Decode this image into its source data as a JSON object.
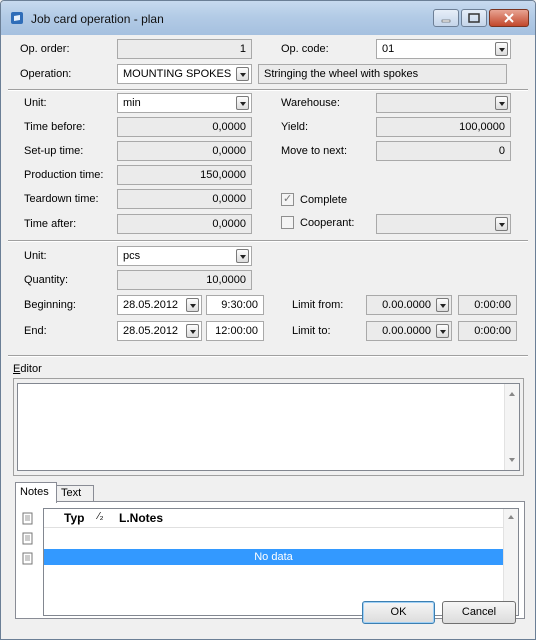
{
  "window": {
    "title": "Job card operation - plan"
  },
  "op": {
    "order_label": "Op. order:",
    "order_value": "1",
    "code_label": "Op. code:",
    "code_value": "01",
    "operation_label": "Operation:",
    "operation_value": "MOUNTING SPOKES",
    "operation_desc": "Stringing the wheel with spokes"
  },
  "time": {
    "unit_label": "Unit:",
    "unit_value": "min",
    "warehouse_label": "Warehouse:",
    "warehouse_value": "",
    "before_label": "Time before:",
    "before_value": "0,0000",
    "yield_label": "Yield:",
    "yield_value": "100,0000",
    "setup_label": "Set-up time:",
    "setup_value": "0,0000",
    "move_label": "Move to next:",
    "move_value": "0",
    "production_label": "Production time:",
    "production_value": "150,0000",
    "teardown_label": "Teardown time:",
    "teardown_value": "0,0000",
    "complete_label": "Complete",
    "complete_checked": true,
    "after_label": "Time after:",
    "after_value": "0,0000",
    "cooperant_label": "Cooperant:",
    "cooperant_checked": false,
    "cooperant_value": ""
  },
  "qty": {
    "unit_label": "Unit:",
    "unit_value": "pcs",
    "quantity_label": "Quantity:",
    "quantity_value": "10,0000",
    "beginning_label": "Beginning:",
    "beginning_date": "28.05.2012",
    "beginning_time": "9:30:00",
    "limit_from_label": "Limit from:",
    "limit_from_date": "0.00.0000",
    "limit_from_time": "0:00:00",
    "end_label": "End:",
    "end_date": "28.05.2012",
    "end_time": "12:00:00",
    "limit_to_label": "Limit to:",
    "limit_to_date": "0.00.0000",
    "limit_to_time": "0:00:00"
  },
  "editor": {
    "label_first": "E",
    "label_rest": "ditor",
    "text": ""
  },
  "notes": {
    "tabs": [
      "Notes",
      "Text"
    ],
    "columns": [
      "Typ",
      "⁄₂",
      "L.Notes"
    ],
    "empty_text": "No data"
  },
  "buttons": {
    "ok": "OK",
    "cancel": "Cancel"
  },
  "colors": {
    "title_bar": "#b3cbe6",
    "selection": "#3399ff",
    "close_button": "#c2472b"
  },
  "icons": [
    "app-icon",
    "minimize-icon",
    "maximize-icon",
    "close-icon",
    "dropdown-arrow-icon",
    "note-icon"
  ]
}
